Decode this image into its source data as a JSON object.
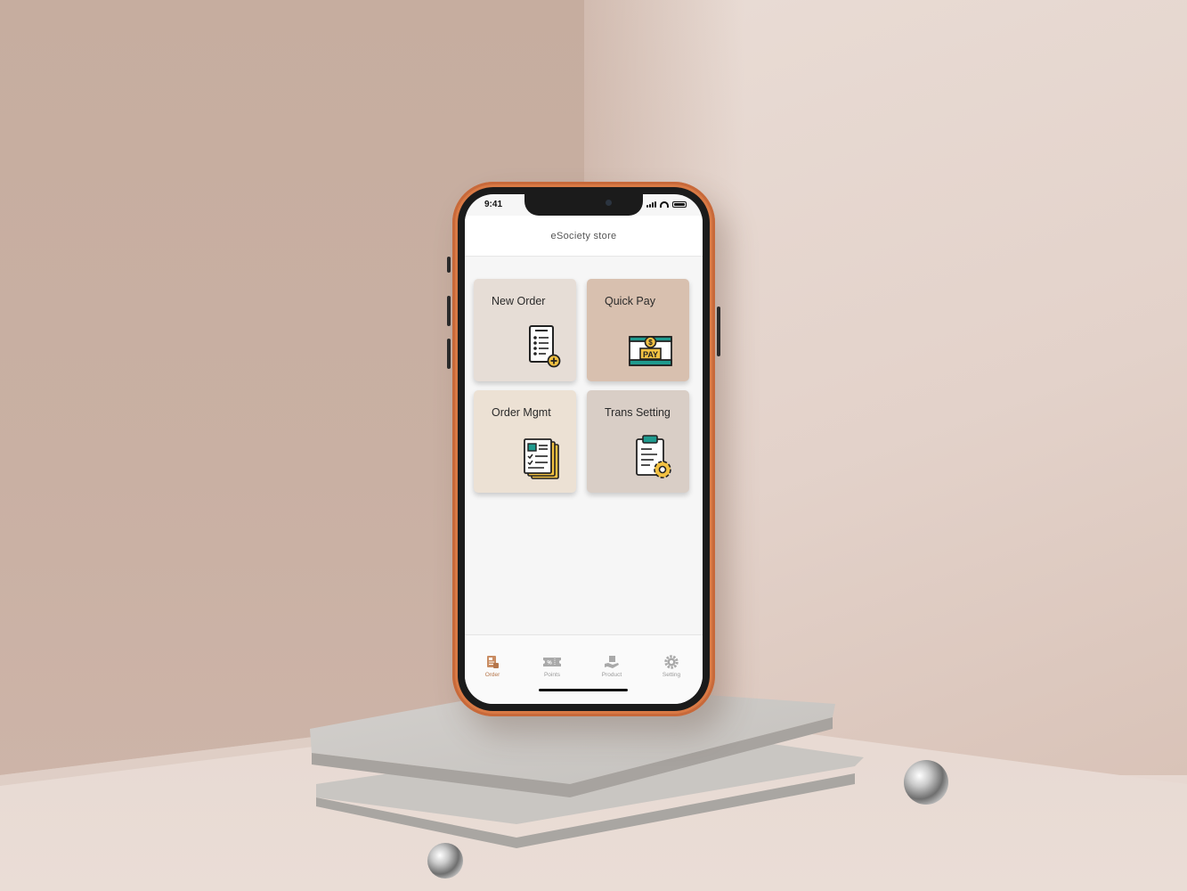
{
  "status_bar": {
    "time": "9:41"
  },
  "header": {
    "title": "eSociety store"
  },
  "tiles": [
    {
      "label": "New Order",
      "bg": "#e6ddd6",
      "icon": "order-list-plus-icon"
    },
    {
      "label": "Quick Pay",
      "bg": "#d8c0af",
      "icon": "pay-screen-coin-icon",
      "icon_text": "PAY",
      "coin_text": "$"
    },
    {
      "label": "Order Mgmt",
      "bg": "#ece1d4",
      "icon": "stacked-documents-icon"
    },
    {
      "label": "Trans Setting",
      "bg": "#d9cec6",
      "icon": "clipboard-gear-icon"
    }
  ],
  "tabbar": {
    "items": [
      {
        "label": "Order",
        "icon": "order-icon",
        "active": true
      },
      {
        "label": "Points",
        "icon": "ticket-icon",
        "active": false
      },
      {
        "label": "Product",
        "icon": "hand-box-icon",
        "active": false
      },
      {
        "label": "Setting",
        "icon": "gear-icon",
        "active": false
      }
    ]
  },
  "colors": {
    "phone_case": "#d97a45",
    "accent": "#b5764b",
    "icon_teal": "#1f9a8e",
    "icon_yellow": "#f2c142"
  }
}
